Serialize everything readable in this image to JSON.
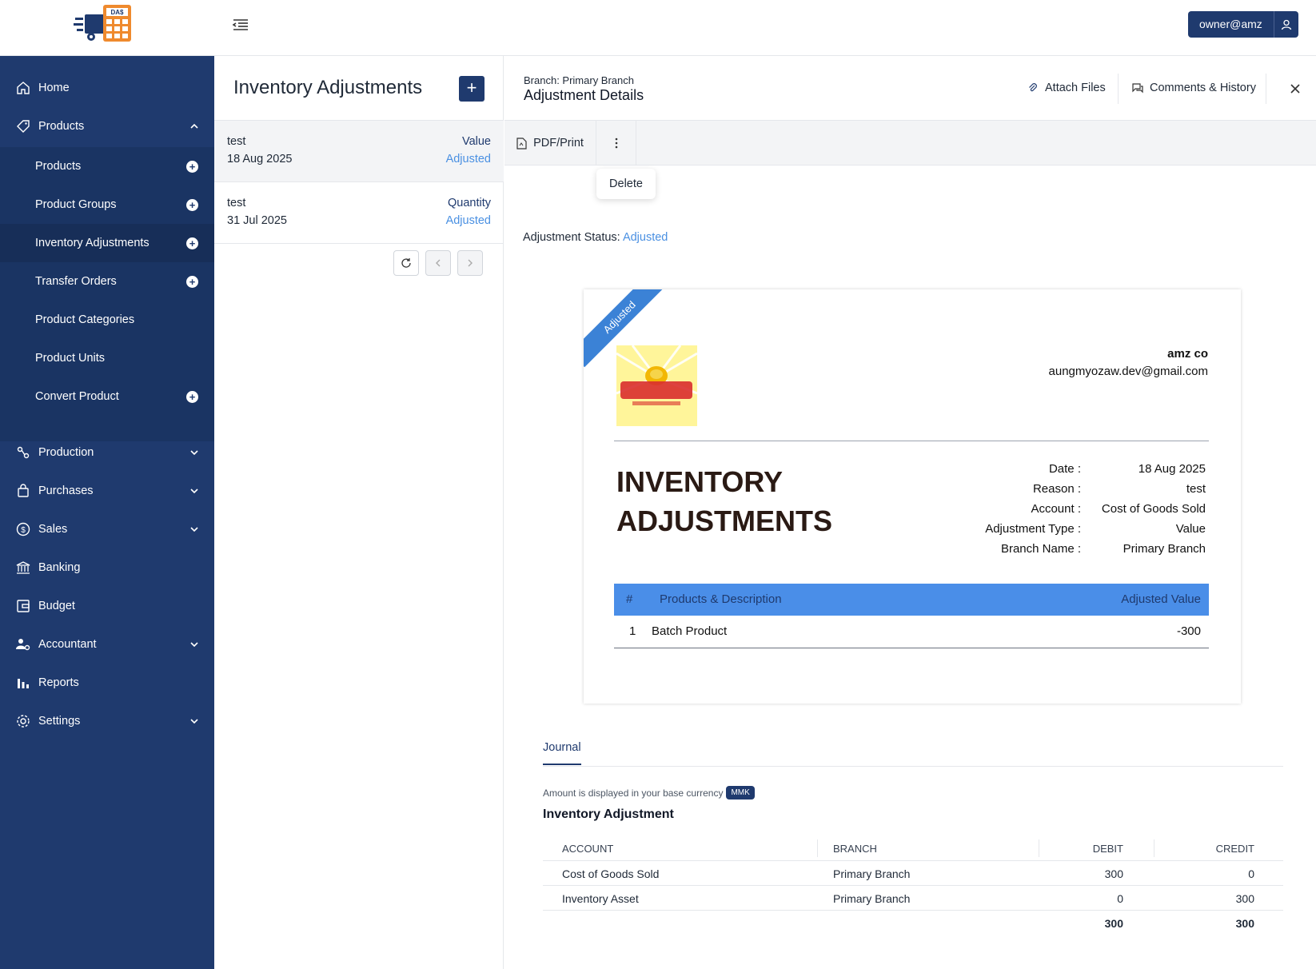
{
  "header": {
    "user_label": "owner@amz",
    "logo_text": "DA$"
  },
  "sidebar": {
    "home": "Home",
    "products": "Products",
    "sub": {
      "products": "Products",
      "product_groups": "Product Groups",
      "inventory_adjustments": "Inventory Adjustments",
      "transfer_orders": "Transfer Orders",
      "product_categories": "Product Categories",
      "product_units": "Product Units",
      "convert_product": "Convert Product"
    },
    "production": "Production",
    "purchases": "Purchases",
    "sales": "Sales",
    "banking": "Banking",
    "budget": "Budget",
    "accountant": "Accountant",
    "reports": "Reports",
    "settings": "Settings",
    "plus_glyph": "+"
  },
  "list": {
    "title": "Inventory Adjustments",
    "add_glyph": "+",
    "items": [
      {
        "name": "test",
        "date": "18 Aug 2025",
        "type": "Value",
        "status": "Adjusted"
      },
      {
        "name": "test",
        "date": "31 Jul 2025",
        "type": "Quantity",
        "status": "Adjusted"
      }
    ]
  },
  "detail": {
    "branch": "Branch: Primary Branch",
    "title": "Adjustment Details",
    "attach": "Attach Files",
    "comments": "Comments & History",
    "pdf": "PDF/Print",
    "delete": "Delete",
    "status_label": "Adjustment Status:",
    "status_value": "Adjusted"
  },
  "document": {
    "ribbon": "Adjusted",
    "company": "amz co",
    "email": "aungmyozaw.dev@gmail.com",
    "heading_line1": "INVENTORY",
    "heading_line2": "ADJUSTMENTS",
    "meta": [
      {
        "key": "Date :",
        "value": "18 Aug 2025"
      },
      {
        "key": "Reason :",
        "value": "test"
      },
      {
        "key": "Account :",
        "value": "Cost of Goods Sold"
      },
      {
        "key": "Adjustment Type :",
        "value": "Value"
      },
      {
        "key": "Branch Name :",
        "value": "Primary Branch"
      }
    ],
    "table_headers": {
      "num": "#",
      "product": "Products & Description",
      "value": "Adjusted Value"
    },
    "rows": [
      {
        "num": "1",
        "product": "Batch Product",
        "value": "-300"
      }
    ]
  },
  "journal": {
    "tab": "Journal",
    "note": "Amount is displayed in your base currency",
    "currency": "MMK",
    "title": "Inventory Adjustment",
    "headers": {
      "account": "ACCOUNT",
      "branch": "BRANCH",
      "debit": "DEBIT",
      "credit": "CREDIT"
    },
    "rows": [
      {
        "account": "Cost of Goods Sold",
        "branch": "Primary Branch",
        "debit": "300",
        "credit": "0"
      },
      {
        "account": "Inventory Asset",
        "branch": "Primary Branch",
        "debit": "0",
        "credit": "300"
      }
    ],
    "total_debit": "300",
    "total_credit": "300"
  },
  "colors": {
    "sidebar": "#1f3a6e",
    "accent": "#4a90e2",
    "ribbon": "#3b82d6",
    "table_header": "#4a8ee8"
  }
}
